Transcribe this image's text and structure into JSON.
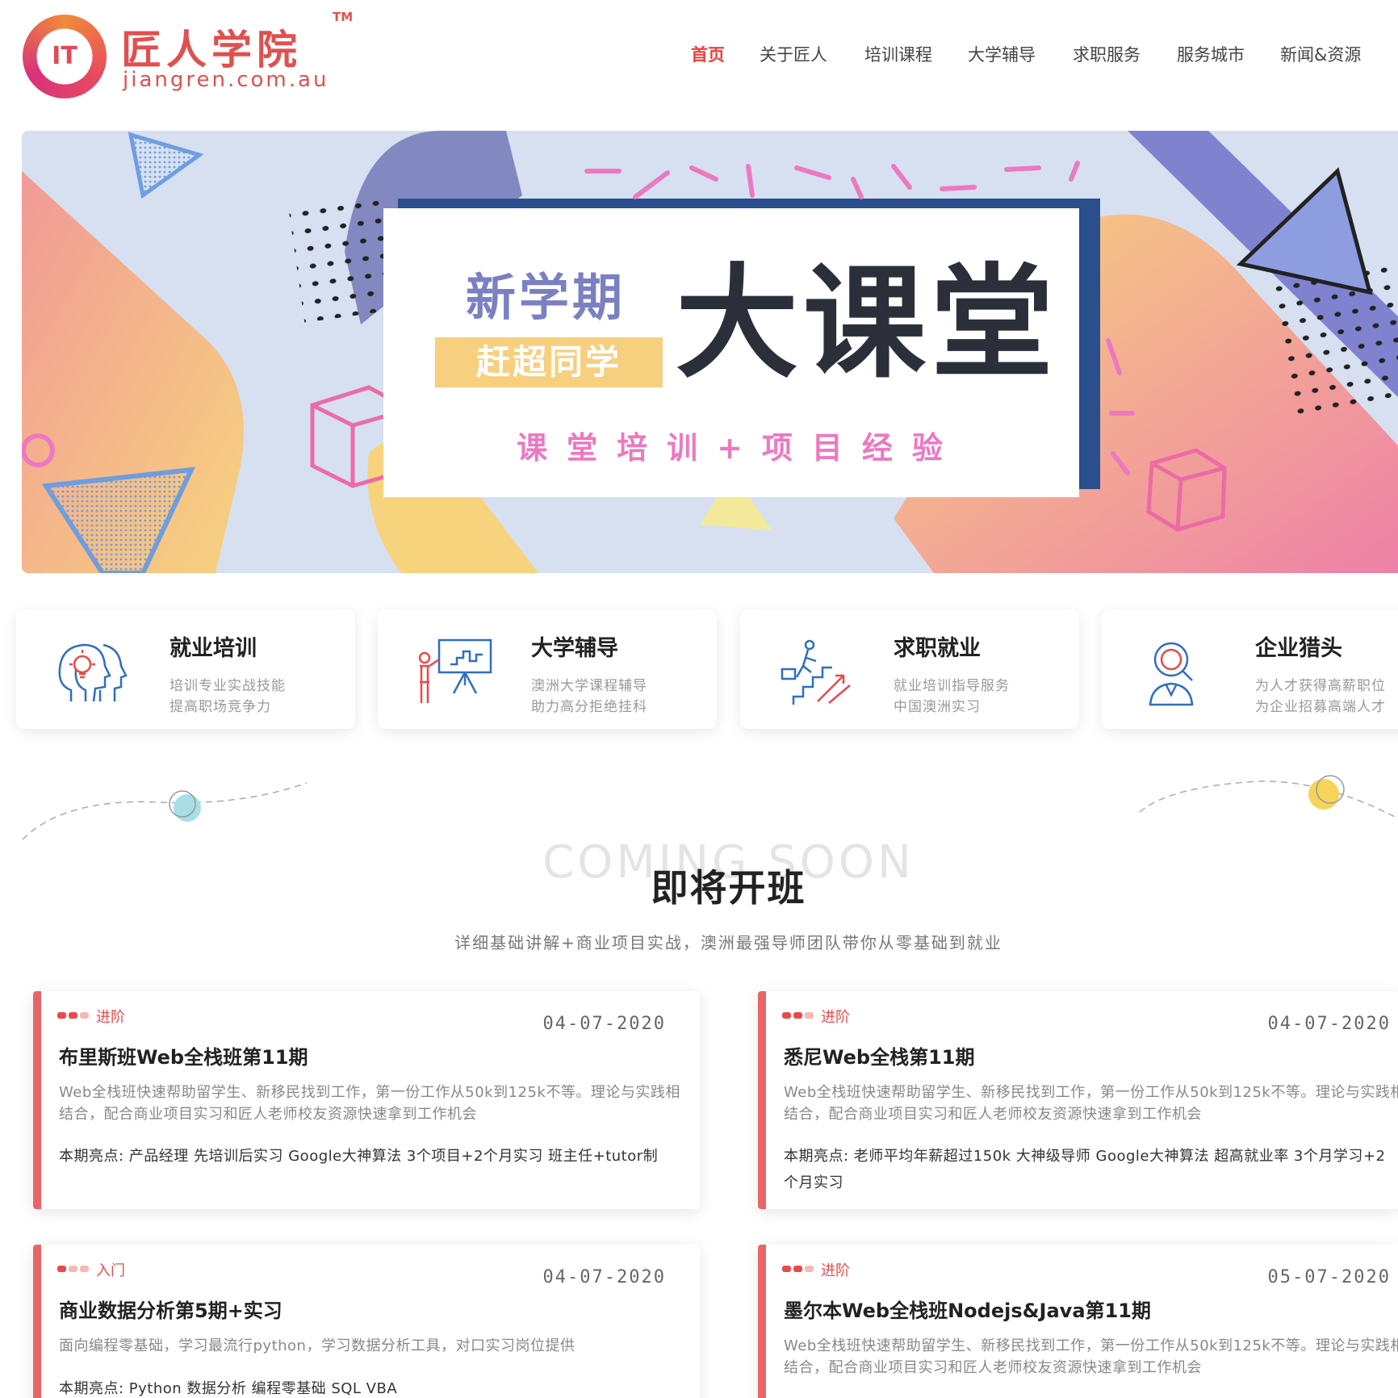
{
  "logo": {
    "mark": "IT",
    "name_cn": "匠人学院",
    "tm": "TM",
    "url": "jiangren.com.au"
  },
  "nav": {
    "items": [
      "首页",
      "关于匠人",
      "培训课程",
      "大学辅导",
      "求职服务",
      "服务城市",
      "新闻&资源"
    ],
    "active_index": 0,
    "active_color": "#e84040"
  },
  "banner": {
    "subtitle": "新学期",
    "tag": "赶超同学",
    "title": "大课堂",
    "tagline": "课堂培训+项目经验"
  },
  "services": [
    {
      "icon": "head-lightbulb-icon",
      "title": "就业培训",
      "line1": "培训专业实战技能",
      "line2": "提高职场竞争力"
    },
    {
      "icon": "teacher-presentation-icon",
      "title": "大学辅导",
      "line1": "澳洲大学课程辅导",
      "line2": "助力高分拒绝挂科"
    },
    {
      "icon": "stairs-climb-icon",
      "title": "求职就业",
      "line1": "就业培训指导服务",
      "line2": "中国澳洲实习"
    },
    {
      "icon": "magnifier-person-icon",
      "title": "企业猎头",
      "line1": "为人才获得高薪职位",
      "line2": "为企业招募高端人才"
    }
  ],
  "section": {
    "bg_text": "COMING SOON",
    "title": "即将开班",
    "subtitle": "详细基础讲解+商业项目实战，澳洲最强导师团队带你从零基础到就业"
  },
  "courses": [
    {
      "level": "进阶",
      "date": "04-07-2020",
      "title": "布里斯班Web全栈班第11期",
      "desc": "Web全栈班快速帮助留学生、新移民找到工作，第一份工作从50k到125k不等。理论与实践相结合，配合商业项目实习和匠人老师校友资源快速拿到工作机会",
      "highlights": "本期亮点: 产品经理 先培训后实习 Google大神算法 3个项目+2个月实习 班主任+tutor制"
    },
    {
      "level": "进阶",
      "date": "04-07-2020",
      "title": "悉尼Web全栈第11期",
      "desc": "Web全栈班快速帮助留学生、新移民找到工作，第一份工作从50k到125k不等。理论与实践相结合，配合商业项目实习和匠人老师校友资源快速拿到工作机会",
      "highlights": "本期亮点: 老师平均年薪超过150k 大神级导师 Google大神算法 超高就业率 3个月学习+2个月实习"
    },
    {
      "level": "入门",
      "date": "04-07-2020",
      "title": "商业数据分析第5期+实习",
      "desc": "面向编程零基础，学习最流行python，学习数据分析工具，对口实习岗位提供",
      "highlights": "本期亮点: Python 数据分析 编程零基础 SQL VBA"
    },
    {
      "level": "进阶",
      "date": "05-07-2020",
      "title": "墨尔本Web全栈班Nodejs&Java第11期",
      "desc": "Web全栈班快速帮助留学生、新移民找到工作，第一份工作从50k到125k不等。理论与实践相结合，配合商业项目实习和匠人老师校友资源快速拿到工作机会",
      "highlights": ""
    }
  ],
  "colors": {
    "brand": "#e0504f",
    "accent_red": "#e84a4a",
    "card_bar": "#e8666a"
  }
}
